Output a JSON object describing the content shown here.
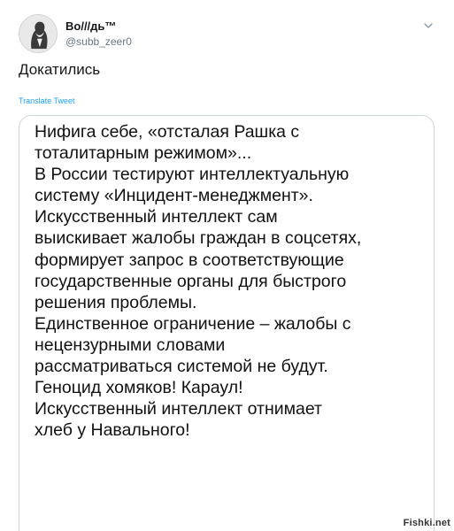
{
  "tweet": {
    "author": {
      "display_name": "Bo///дь™",
      "handle": "@subb_zeer0",
      "avatar_icon": "avatar-icon"
    },
    "menu_icon": "chevron-down-icon",
    "text": "Докатились",
    "translate_label": "Translate Tweet",
    "quoted_text_lines": [
      "Нифига себе, «отсталая Рашка с",
      "тоталитарным режимом»...",
      "В России тестируют интеллектуальную",
      "систему «Инцидент-менеджмент».",
      "Искусственный интеллект сам",
      "выискивает жалобы граждан в соцсетях,",
      "формирует запрос в соответствующие",
      "государственные органы для быстрого",
      "решения проблемы.",
      "Единственное ограничение – жалобы с",
      "нецензурными словами",
      "рассматриваться системой не будут.",
      "Геноцид хомяков! Караул!",
      "Искусственный интеллект отнимает",
      "хлеб у Навального!"
    ]
  },
  "watermark": "Fishki.net",
  "colors": {
    "link": "#1da1f2",
    "secondary_text": "#657786",
    "border": "#ccd6dd"
  }
}
